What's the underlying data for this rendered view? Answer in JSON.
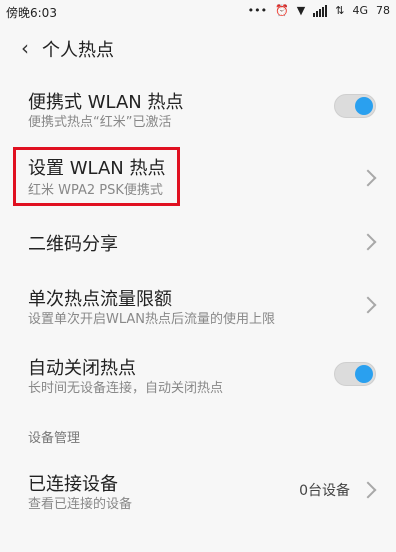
{
  "status": {
    "time": "傍晚6:03",
    "network": "4G",
    "battery": "78"
  },
  "header": {
    "title": "个人热点"
  },
  "rows": [
    {
      "title": "便携式 WLAN 热点",
      "subtitle": "便携式热点“红米”已激活",
      "control": "toggle",
      "on": true
    },
    {
      "title": "设置 WLAN 热点",
      "subtitle": "红米 WPA2 PSK便携式",
      "control": "chevron"
    },
    {
      "title": "二维码分享",
      "control": "chevron"
    },
    {
      "title": "单次热点流量限额",
      "subtitle": "设置单次开启WLAN热点后流量的使用上限",
      "control": "chevron"
    },
    {
      "title": "自动关闭热点",
      "subtitle": "长时间无设备连接，自动关闭热点",
      "control": "toggle",
      "on": true
    }
  ],
  "section": {
    "label": "设备管理"
  },
  "connected": {
    "title": "已连接设备",
    "subtitle": "查看已连接的设备",
    "value": "0台设备"
  },
  "colors": {
    "accent": "#2aa0ef",
    "highlight": "#e01020"
  }
}
